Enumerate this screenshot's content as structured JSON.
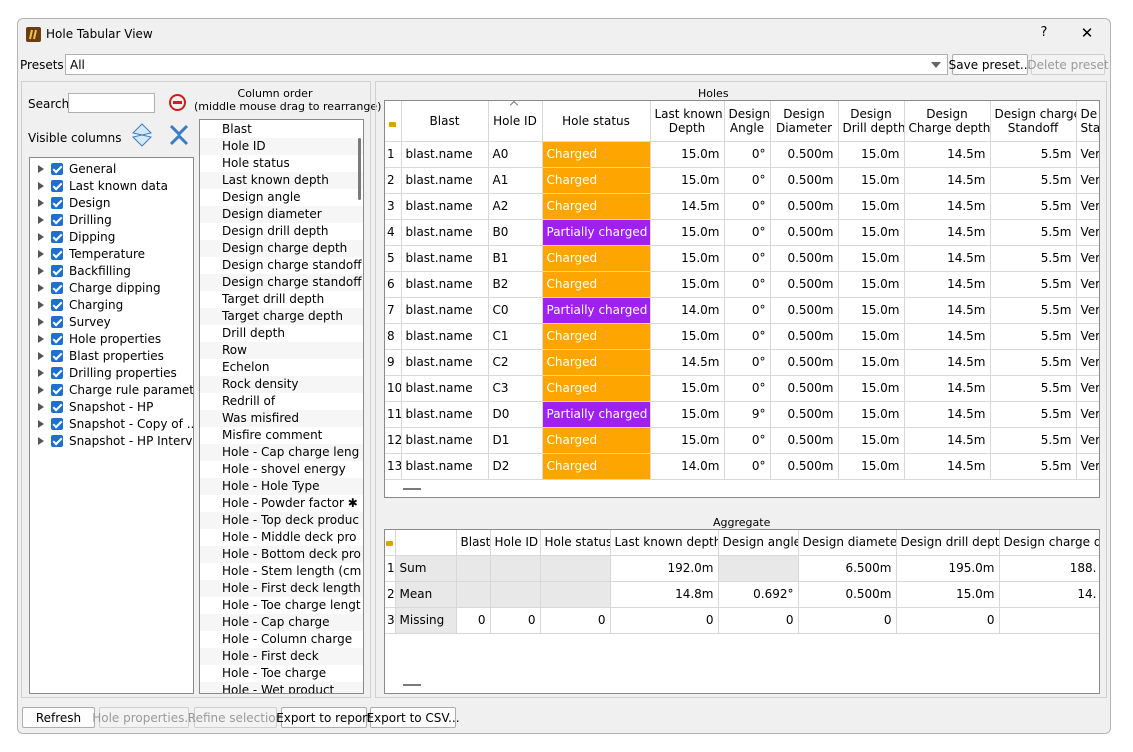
{
  "window": {
    "title": "Hole Tabular View",
    "help": "?",
    "close": "✕"
  },
  "presets": {
    "label": "Presets",
    "value": "All",
    "save": "Save preset...",
    "delete": "Delete preset"
  },
  "left": {
    "search_label": "Search",
    "visible_label": "Visible columns",
    "groups": [
      "General",
      "Last known data",
      "Design",
      "Drilling",
      "Dipping",
      "Temperature",
      "Backfilling",
      "Charge dipping",
      "Charging",
      "Survey",
      "Hole properties",
      "Blast properties",
      "Drilling properties",
      "Charge rule parameter",
      "Snapshot - HP",
      "Snapshot - Copy of ...",
      "Snapshot - HP Interval"
    ]
  },
  "column_order": {
    "title1": "Column order",
    "title2": "(middle mouse drag to rearrange)",
    "items": [
      "Blast",
      "Hole ID",
      "Hole status",
      "Last known depth",
      "Design angle",
      "Design diameter",
      "Design drill depth",
      "Design charge depth",
      "Design charge standoff",
      "Design charge standoff",
      "Target drill depth",
      "Target charge depth",
      "Drill depth",
      "Row",
      "Echelon",
      "Rock density",
      "Redrill of",
      "Was misfired",
      "Misfire comment",
      "Hole - Cap charge leng",
      "Hole - shovel energy",
      "Hole - Hole Type",
      "Hole - Powder factor ✱",
      "Hole - Top deck produc",
      "Hole - Middle deck pro",
      "Hole - Bottom deck pro",
      "Hole - Stem length (cm",
      "Hole - First deck length",
      "Hole - Toe charge lengt",
      "Hole - Cap charge",
      "Hole - Column charge",
      "Hole - First deck",
      "Hole - Toe charge",
      "Hole - Wet product"
    ]
  },
  "holes": {
    "title": "Holes",
    "headers": {
      "blast": "Blast",
      "hole_id": "Hole ID",
      "status": "Hole status",
      "lkd1": "Last known",
      "lkd2": "Depth",
      "dang1": "Design",
      "dang2": "Angle",
      "ddia1": "Design",
      "ddia2": "Diameter",
      "ddd1": "Design",
      "ddd2": "Drill depth",
      "dcd1": "Design",
      "dcd2": "Charge depth",
      "dcs1": "Design charge",
      "dcs2": "Standoff",
      "dcs_b1": "De",
      "dcs_b2": "Stand"
    },
    "rows": [
      {
        "n": "1",
        "blast": "blast.name",
        "id": "A0",
        "status": "Charged",
        "lkd": "15.0m",
        "ang": "0°",
        "dia": "0.500m",
        "ddd": "15.0m",
        "dcd": "14.5m",
        "dcs": "5.5m",
        "tail": "Vertic"
      },
      {
        "n": "2",
        "blast": "blast.name",
        "id": "A1",
        "status": "Charged",
        "lkd": "15.0m",
        "ang": "0°",
        "dia": "0.500m",
        "ddd": "15.0m",
        "dcd": "14.5m",
        "dcs": "5.5m",
        "tail": "Vertic"
      },
      {
        "n": "3",
        "blast": "blast.name",
        "id": "A2",
        "status": "Charged",
        "lkd": "14.5m",
        "ang": "0°",
        "dia": "0.500m",
        "ddd": "15.0m",
        "dcd": "14.5m",
        "dcs": "5.5m",
        "tail": "Vertic"
      },
      {
        "n": "4",
        "blast": "blast.name",
        "id": "B0",
        "status": "Partially charged",
        "lkd": "15.0m",
        "ang": "0°",
        "dia": "0.500m",
        "ddd": "15.0m",
        "dcd": "14.5m",
        "dcs": "5.5m",
        "tail": "Vertic"
      },
      {
        "n": "5",
        "blast": "blast.name",
        "id": "B1",
        "status": "Charged",
        "lkd": "15.0m",
        "ang": "0°",
        "dia": "0.500m",
        "ddd": "15.0m",
        "dcd": "14.5m",
        "dcs": "5.5m",
        "tail": "Vertic"
      },
      {
        "n": "6",
        "blast": "blast.name",
        "id": "B2",
        "status": "Charged",
        "lkd": "15.0m",
        "ang": "0°",
        "dia": "0.500m",
        "ddd": "15.0m",
        "dcd": "14.5m",
        "dcs": "5.5m",
        "tail": "Vertic"
      },
      {
        "n": "7",
        "blast": "blast.name",
        "id": "C0",
        "status": "Partially charged",
        "lkd": "14.0m",
        "ang": "0°",
        "dia": "0.500m",
        "ddd": "15.0m",
        "dcd": "14.5m",
        "dcs": "5.5m",
        "tail": "Vertic"
      },
      {
        "n": "8",
        "blast": "blast.name",
        "id": "C1",
        "status": "Charged",
        "lkd": "15.0m",
        "ang": "0°",
        "dia": "0.500m",
        "ddd": "15.0m",
        "dcd": "14.5m",
        "dcs": "5.5m",
        "tail": "Vertic"
      },
      {
        "n": "9",
        "blast": "blast.name",
        "id": "C2",
        "status": "Charged",
        "lkd": "14.5m",
        "ang": "0°",
        "dia": "0.500m",
        "ddd": "15.0m",
        "dcd": "14.5m",
        "dcs": "5.5m",
        "tail": "Vertic"
      },
      {
        "n": "10",
        "blast": "blast.name",
        "id": "C3",
        "status": "Charged",
        "lkd": "15.0m",
        "ang": "0°",
        "dia": "0.500m",
        "ddd": "15.0m",
        "dcd": "14.5m",
        "dcs": "5.5m",
        "tail": "Vertic"
      },
      {
        "n": "11",
        "blast": "blast.name",
        "id": "D0",
        "status": "Partially charged",
        "lkd": "15.0m",
        "ang": "9°",
        "dia": "0.500m",
        "ddd": "15.0m",
        "dcd": "14.5m",
        "dcs": "5.5m",
        "tail": "Vertic"
      },
      {
        "n": "12",
        "blast": "blast.name",
        "id": "D1",
        "status": "Charged",
        "lkd": "15.0m",
        "ang": "0°",
        "dia": "0.500m",
        "ddd": "15.0m",
        "dcd": "14.5m",
        "dcs": "5.5m",
        "tail": "Vertic"
      },
      {
        "n": "13",
        "blast": "blast.name",
        "id": "D2",
        "status": "Charged",
        "lkd": "14.0m",
        "ang": "0°",
        "dia": "0.500m",
        "ddd": "15.0m",
        "dcd": "14.5m",
        "dcs": "5.5m",
        "tail": "Vertic"
      }
    ]
  },
  "aggregate": {
    "title": "Aggregate",
    "headers": [
      "Blast",
      "Hole ID",
      "Hole status",
      "Last known depth",
      "Design angle",
      "Design diameter",
      "Design drill depth",
      "Design charge dep"
    ],
    "rows": [
      {
        "n": "1",
        "label": "Sum",
        "cells": [
          "",
          "",
          "",
          "192.0m",
          "",
          "6.500m",
          "195.0m",
          "188."
        ]
      },
      {
        "n": "2",
        "label": "Mean",
        "cells": [
          "",
          "",
          "",
          "14.8m",
          "0.692°",
          "0.500m",
          "15.0m",
          "14."
        ]
      },
      {
        "n": "3",
        "label": "Missing",
        "cells": [
          "0",
          "0",
          "0",
          "0",
          "0",
          "0",
          "0",
          ""
        ]
      }
    ]
  },
  "bottom": {
    "refresh": "Refresh",
    "hole_props": "Hole properties...",
    "refine": "Refine selection",
    "export_report": "Export to report",
    "export_csv": "Export to CSV..."
  },
  "colors": {
    "charged": "#ffa500",
    "partial": "#a020f0",
    "accent": "#1f6fd0"
  }
}
